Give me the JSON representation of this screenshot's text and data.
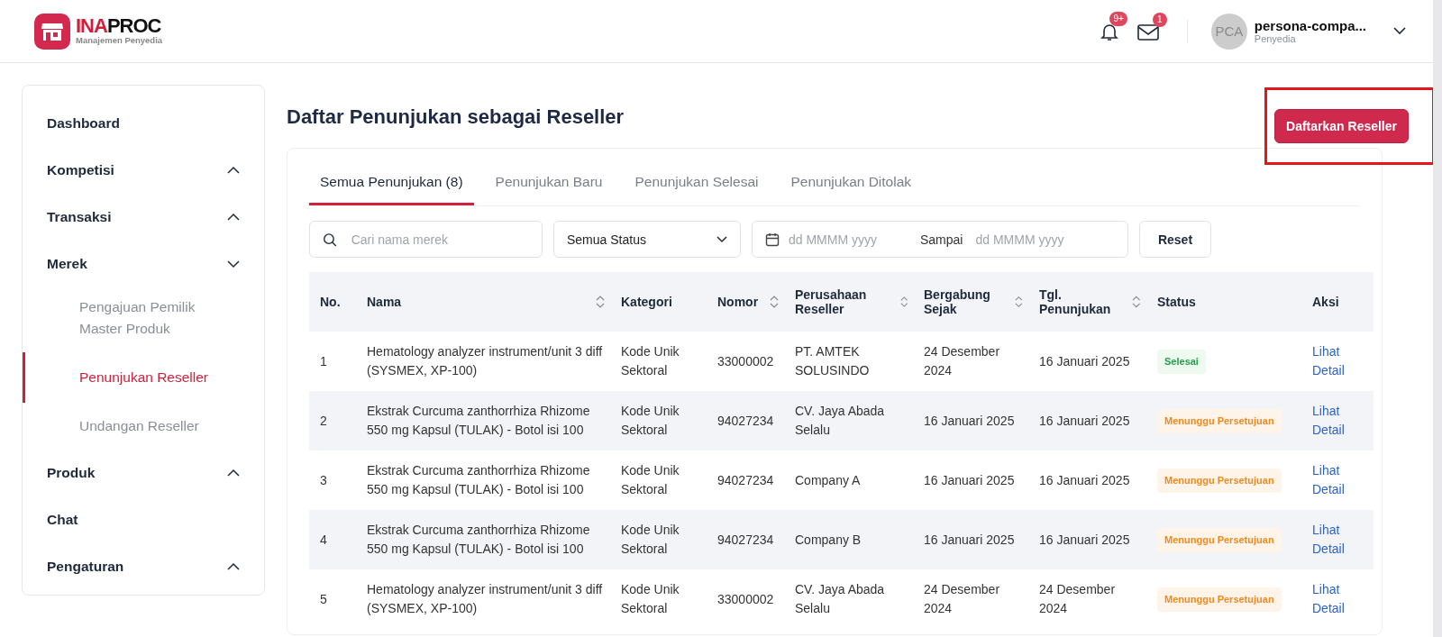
{
  "header": {
    "logo": {
      "brand_part1": "INA",
      "brand_part2": "PROC",
      "subtitle": "Manajemen Penyedia"
    },
    "notifications": {
      "badge": "9+"
    },
    "messages": {
      "badge": "1"
    },
    "user": {
      "initials": "PCA",
      "name": "persona-compa...",
      "role": "Penyedia"
    }
  },
  "sidebar": {
    "items": [
      {
        "label": "Dashboard",
        "selected": false
      },
      {
        "label": "Kompetisi",
        "expanded": false,
        "selected": false
      },
      {
        "label": "Transaksi",
        "expanded": false,
        "selected": false
      },
      {
        "label": "Merek",
        "expanded": true,
        "selected": false,
        "children": [
          {
            "label": "Pengajuan Pemilik Master Produk",
            "selected": false
          },
          {
            "label": "Penunjukan Reseller",
            "selected": true
          },
          {
            "label": "Undangan Reseller",
            "selected": false
          }
        ]
      },
      {
        "label": "Produk",
        "expanded": false,
        "selected": false
      },
      {
        "label": "Chat",
        "selected": false
      },
      {
        "label": "Pengaturan",
        "expanded": false,
        "selected": false
      }
    ]
  },
  "page": {
    "title": "Daftar Penunjukan sebagai Reseller",
    "primary_button": {
      "label": "Daftarkan Reseller",
      "highlighted": true
    }
  },
  "tabs": [
    {
      "label": "Semua Penunjukan (8)",
      "selected": true
    },
    {
      "label": "Penunjukan Baru",
      "selected": false
    },
    {
      "label": "Penunjukan Selesai",
      "selected": false
    },
    {
      "label": "Penunjukan Ditolak",
      "selected": false
    }
  ],
  "filters": {
    "search": {
      "placeholder": "Cari nama merek"
    },
    "status": {
      "value": "Semua Status"
    },
    "date_range": {
      "from_placeholder": "dd MMMM yyyy",
      "separator": "Sampai",
      "to_placeholder": "dd MMMM yyyy"
    },
    "reset": "Reset"
  },
  "table": {
    "columns": [
      {
        "label": "No.",
        "sortable": false
      },
      {
        "label": "Nama",
        "sortable": true
      },
      {
        "label": "Kategori",
        "sortable": false
      },
      {
        "label": "Nomor",
        "sortable": true
      },
      {
        "label": "Perusahaan Reseller",
        "sortable": true
      },
      {
        "label": "Bergabung Sejak",
        "sortable": true
      },
      {
        "label": "Tgl. Penunjukan",
        "sortable": true
      },
      {
        "label": "Status",
        "sortable": false
      },
      {
        "label": "Aksi",
        "sortable": false
      }
    ],
    "rows": [
      {
        "no": "1",
        "nama": "Hematology analyzer instrument/unit 3 diff (SYSMEX, XP-100)",
        "kategori": "Kode Unik Sektoral",
        "nomor": "33000002",
        "perusahaan": "PT. AMTEK SOLUSINDO",
        "bergabung": "24 Desember 2024",
        "tgl": "16 Januari 2025",
        "status": {
          "label": "Selesai",
          "kind": "done"
        },
        "aksi": "Lihat Detail"
      },
      {
        "no": "2",
        "nama": "Ekstrak Curcuma zanthorrhiza Rhizome 550 mg Kapsul (TULAK) - Botol isi 100",
        "kategori": "Kode Unik Sektoral",
        "nomor": "94027234",
        "perusahaan": "CV. Jaya Abada Selalu",
        "bergabung": "16 Januari 2025",
        "tgl": "16 Januari 2025",
        "status": {
          "label": "Menunggu Persetujuan",
          "kind": "waiting"
        },
        "aksi": "Lihat Detail"
      },
      {
        "no": "3",
        "nama": "Ekstrak Curcuma zanthorrhiza Rhizome 550 mg Kapsul (TULAK) - Botol isi 100",
        "kategori": "Kode Unik Sektoral",
        "nomor": "94027234",
        "perusahaan": "Company A",
        "bergabung": "16 Januari 2025",
        "tgl": "16 Januari 2025",
        "status": {
          "label": "Menunggu Persetujuan",
          "kind": "waiting"
        },
        "aksi": "Lihat Detail"
      },
      {
        "no": "4",
        "nama": "Ekstrak Curcuma zanthorrhiza Rhizome 550 mg Kapsul (TULAK) - Botol isi 100",
        "kategori": "Kode Unik Sektoral",
        "nomor": "94027234",
        "perusahaan": "Company B",
        "bergabung": "16 Januari 2025",
        "tgl": "16 Januari 2025",
        "status": {
          "label": "Menunggu Persetujuan",
          "kind": "waiting"
        },
        "aksi": "Lihat Detail"
      },
      {
        "no": "5",
        "nama": "Hematology analyzer instrument/unit 3 diff (SYSMEX, XP-100)",
        "kategori": "Kode Unik Sektoral",
        "nomor": "33000002",
        "perusahaan": "CV. Jaya Abada Selalu",
        "bergabung": "24 Desember 2024",
        "tgl": "24 Desember 2024",
        "status": {
          "label": "Menunggu Persetujuan",
          "kind": "waiting"
        },
        "aksi": "Lihat Detail"
      }
    ]
  }
}
